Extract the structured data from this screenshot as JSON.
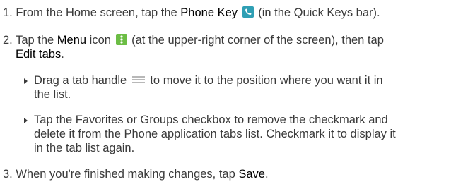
{
  "steps": [
    {
      "num": "1.",
      "text_a": "From the Home screen, tap the ",
      "strong_a": "Phone Key",
      "icon_a": "phone-key-icon",
      "text_b": " (in the Quick Keys bar)."
    },
    {
      "num": "2.",
      "text_a": "Tap the ",
      "strong_a": "Menu",
      "text_b": " icon ",
      "icon_a": "menu-icon",
      "text_c": " (at the upper-right corner of the screen), then tap",
      "strong_b": "Edit tabs",
      "text_d": ".",
      "bullets": [
        {
          "line1_a": "Drag a tab handle ",
          "icon": "drag-handle-icon",
          "line1_b": " to move it to the position where you want it in",
          "line2": "the list."
        },
        {
          "line1": "Tap the Favorites or Groups checkbox to remove the checkmark and",
          "line2": "delete it from the Phone application tabs list. Checkmark it to display it",
          "line3": "in the tab list again."
        }
      ]
    },
    {
      "num": "3.",
      "text_a": "When you're finished making changes, tap ",
      "strong_a": "Save",
      "text_b": "."
    }
  ],
  "colors": {
    "body_text": "#3a3a3a",
    "ui_term": "#000000",
    "phone_key_bg": "#2f9fb4",
    "menu_icon_bg": "#6cbd45",
    "drag_handle": "#b8b8b8"
  }
}
